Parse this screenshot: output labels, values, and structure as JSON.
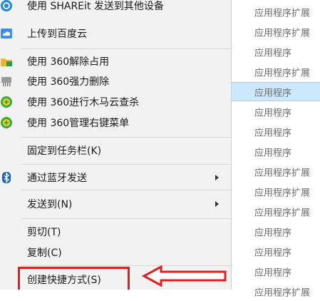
{
  "context_menu": {
    "items": [
      {
        "label": "使用 SHAREit 发送到其他设备",
        "icon": "shareit-icon"
      },
      {
        "label": "上传到百度云",
        "icon": "baidu-cloud-icon"
      },
      {
        "label": "使用 360解除占用",
        "icon": "360-unlock-icon"
      },
      {
        "label": "使用 360强力删除",
        "icon": "360-shred-icon"
      },
      {
        "label": "使用 360进行木马云查杀",
        "icon": "360-scan-icon"
      },
      {
        "label": "使用 360管理右键菜单",
        "icon": "360-menu-icon"
      },
      {
        "label": "固定到任务栏(K)"
      },
      {
        "label": "通过蓝牙发送",
        "icon": "bluetooth-icon",
        "submenu": true
      },
      {
        "label": "发送到(N)",
        "submenu": true
      },
      {
        "label": "剪切(T)"
      },
      {
        "label": "复制(C)"
      },
      {
        "label": "创建快捷方式(S)"
      }
    ]
  },
  "annotation": {
    "color": "#e02020"
  },
  "file_types": [
    "应用程序扩展",
    "应用程序扩展",
    "应用程序",
    "应用程序扩展",
    "应用程序",
    "应用程序",
    "应用程序",
    "应用程序",
    "应用程序扩展",
    "应用程序扩展",
    "应用程序扩展",
    "应用程序",
    "应用程序",
    "应用程序",
    "应用程序扩展"
  ],
  "selected_file_type_index": 4
}
